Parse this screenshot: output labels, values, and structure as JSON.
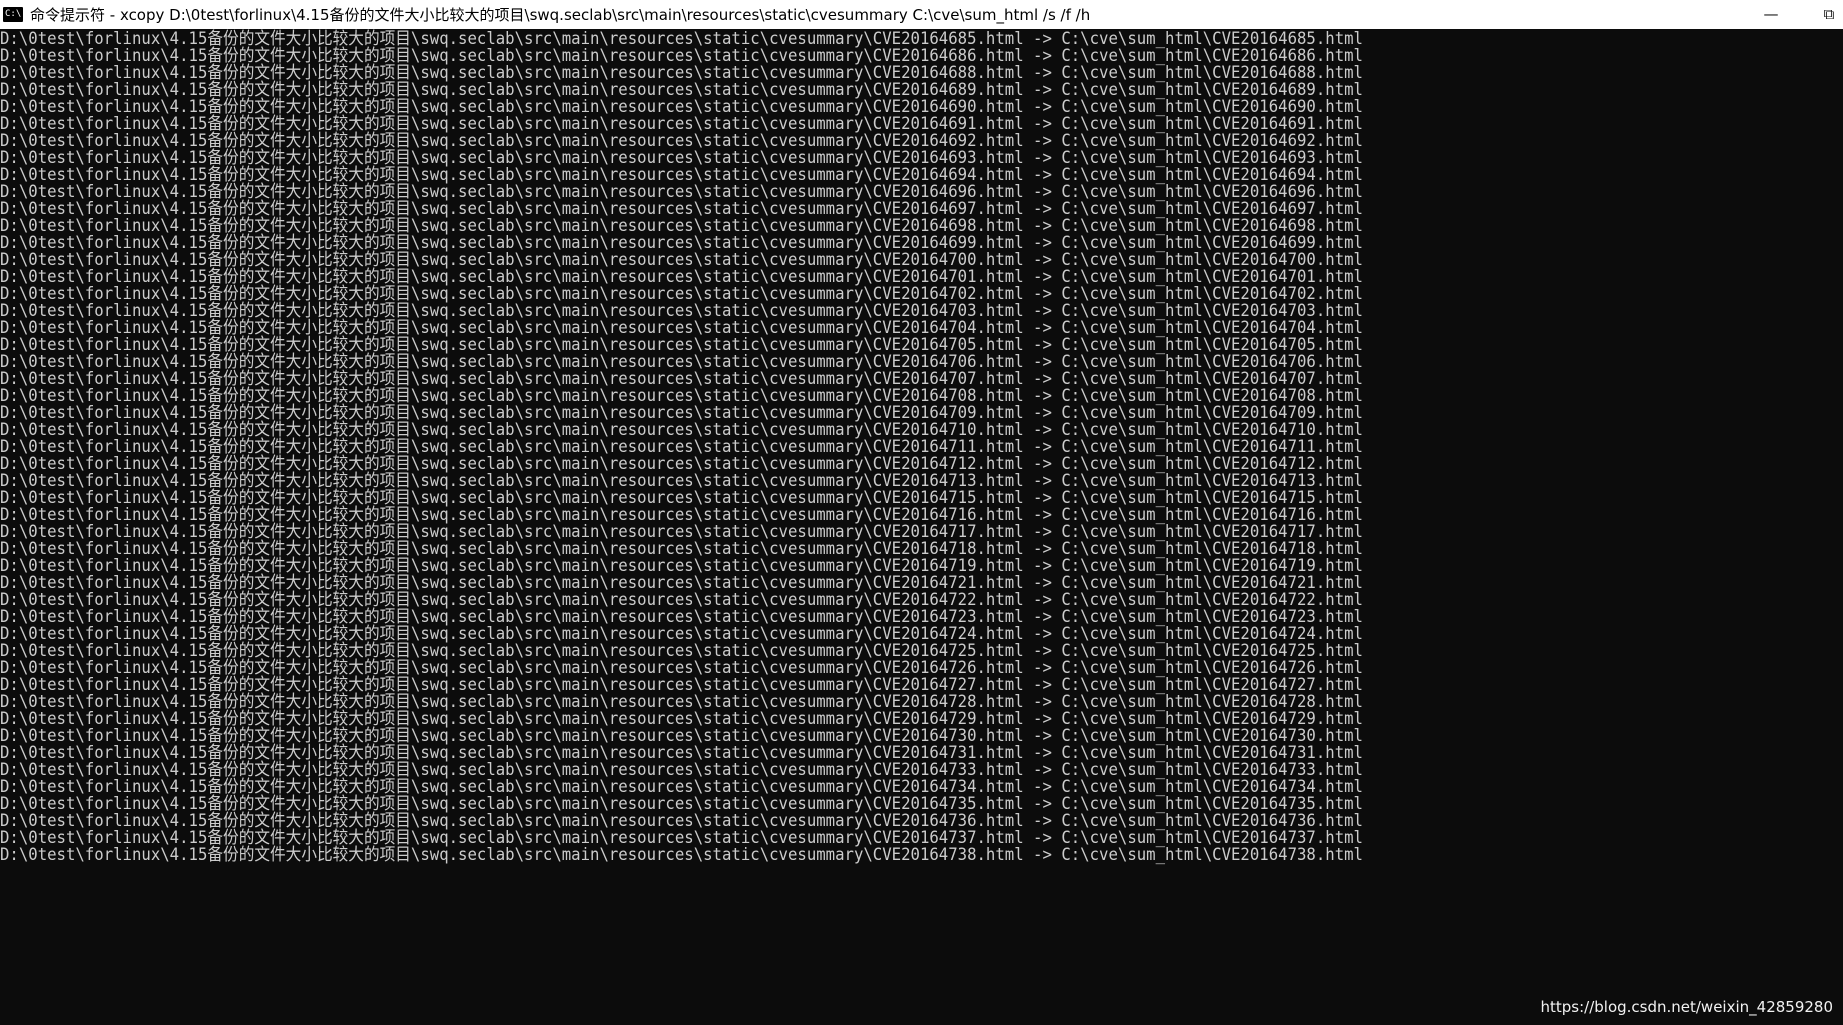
{
  "window": {
    "title": "命令提示符 - xcopy  D:\\0test\\forlinux\\4.15备份的文件大小比较大的项目\\swq.seclab\\src\\main\\resources\\static\\cvesummary C:\\cve\\sum_html /s /f /h",
    "icon_text": "C:\\",
    "minimize_glyph": "—",
    "maximize_glyph": "⧉"
  },
  "console": {
    "lines": [
      "D:\\0test\\forlinux\\4.15备份的文件大小比较大的项目\\swq.seclab\\src\\main\\resources\\static\\cvesummary\\CVE20164685.html -> C:\\cve\\sum_html\\CVE20164685.html",
      "D:\\0test\\forlinux\\4.15备份的文件大小比较大的项目\\swq.seclab\\src\\main\\resources\\static\\cvesummary\\CVE20164686.html -> C:\\cve\\sum_html\\CVE20164686.html",
      "D:\\0test\\forlinux\\4.15备份的文件大小比较大的项目\\swq.seclab\\src\\main\\resources\\static\\cvesummary\\CVE20164688.html -> C:\\cve\\sum_html\\CVE20164688.html",
      "D:\\0test\\forlinux\\4.15备份的文件大小比较大的项目\\swq.seclab\\src\\main\\resources\\static\\cvesummary\\CVE20164689.html -> C:\\cve\\sum_html\\CVE20164689.html",
      "D:\\0test\\forlinux\\4.15备份的文件大小比较大的项目\\swq.seclab\\src\\main\\resources\\static\\cvesummary\\CVE20164690.html -> C:\\cve\\sum_html\\CVE20164690.html",
      "D:\\0test\\forlinux\\4.15备份的文件大小比较大的项目\\swq.seclab\\src\\main\\resources\\static\\cvesummary\\CVE20164691.html -> C:\\cve\\sum_html\\CVE20164691.html",
      "D:\\0test\\forlinux\\4.15备份的文件大小比较大的项目\\swq.seclab\\src\\main\\resources\\static\\cvesummary\\CVE20164692.html -> C:\\cve\\sum_html\\CVE20164692.html",
      "D:\\0test\\forlinux\\4.15备份的文件大小比较大的项目\\swq.seclab\\src\\main\\resources\\static\\cvesummary\\CVE20164693.html -> C:\\cve\\sum_html\\CVE20164693.html",
      "D:\\0test\\forlinux\\4.15备份的文件大小比较大的项目\\swq.seclab\\src\\main\\resources\\static\\cvesummary\\CVE20164694.html -> C:\\cve\\sum_html\\CVE20164694.html",
      "D:\\0test\\forlinux\\4.15备份的文件大小比较大的项目\\swq.seclab\\src\\main\\resources\\static\\cvesummary\\CVE20164696.html -> C:\\cve\\sum_html\\CVE20164696.html",
      "D:\\0test\\forlinux\\4.15备份的文件大小比较大的项目\\swq.seclab\\src\\main\\resources\\static\\cvesummary\\CVE20164697.html -> C:\\cve\\sum_html\\CVE20164697.html",
      "D:\\0test\\forlinux\\4.15备份的文件大小比较大的项目\\swq.seclab\\src\\main\\resources\\static\\cvesummary\\CVE20164698.html -> C:\\cve\\sum_html\\CVE20164698.html",
      "D:\\0test\\forlinux\\4.15备份的文件大小比较大的项目\\swq.seclab\\src\\main\\resources\\static\\cvesummary\\CVE20164699.html -> C:\\cve\\sum_html\\CVE20164699.html",
      "D:\\0test\\forlinux\\4.15备份的文件大小比较大的项目\\swq.seclab\\src\\main\\resources\\static\\cvesummary\\CVE20164700.html -> C:\\cve\\sum_html\\CVE20164700.html",
      "D:\\0test\\forlinux\\4.15备份的文件大小比较大的项目\\swq.seclab\\src\\main\\resources\\static\\cvesummary\\CVE20164701.html -> C:\\cve\\sum_html\\CVE20164701.html",
      "D:\\0test\\forlinux\\4.15备份的文件大小比较大的项目\\swq.seclab\\src\\main\\resources\\static\\cvesummary\\CVE20164702.html -> C:\\cve\\sum_html\\CVE20164702.html",
      "D:\\0test\\forlinux\\4.15备份的文件大小比较大的项目\\swq.seclab\\src\\main\\resources\\static\\cvesummary\\CVE20164703.html -> C:\\cve\\sum_html\\CVE20164703.html",
      "D:\\0test\\forlinux\\4.15备份的文件大小比较大的项目\\swq.seclab\\src\\main\\resources\\static\\cvesummary\\CVE20164704.html -> C:\\cve\\sum_html\\CVE20164704.html",
      "D:\\0test\\forlinux\\4.15备份的文件大小比较大的项目\\swq.seclab\\src\\main\\resources\\static\\cvesummary\\CVE20164705.html -> C:\\cve\\sum_html\\CVE20164705.html",
      "D:\\0test\\forlinux\\4.15备份的文件大小比较大的项目\\swq.seclab\\src\\main\\resources\\static\\cvesummary\\CVE20164706.html -> C:\\cve\\sum_html\\CVE20164706.html",
      "D:\\0test\\forlinux\\4.15备份的文件大小比较大的项目\\swq.seclab\\src\\main\\resources\\static\\cvesummary\\CVE20164707.html -> C:\\cve\\sum_html\\CVE20164707.html",
      "D:\\0test\\forlinux\\4.15备份的文件大小比较大的项目\\swq.seclab\\src\\main\\resources\\static\\cvesummary\\CVE20164708.html -> C:\\cve\\sum_html\\CVE20164708.html",
      "D:\\0test\\forlinux\\4.15备份的文件大小比较大的项目\\swq.seclab\\src\\main\\resources\\static\\cvesummary\\CVE20164709.html -> C:\\cve\\sum_html\\CVE20164709.html",
      "D:\\0test\\forlinux\\4.15备份的文件大小比较大的项目\\swq.seclab\\src\\main\\resources\\static\\cvesummary\\CVE20164710.html -> C:\\cve\\sum_html\\CVE20164710.html",
      "D:\\0test\\forlinux\\4.15备份的文件大小比较大的项目\\swq.seclab\\src\\main\\resources\\static\\cvesummary\\CVE20164711.html -> C:\\cve\\sum_html\\CVE20164711.html",
      "D:\\0test\\forlinux\\4.15备份的文件大小比较大的项目\\swq.seclab\\src\\main\\resources\\static\\cvesummary\\CVE20164712.html -> C:\\cve\\sum_html\\CVE20164712.html",
      "D:\\0test\\forlinux\\4.15备份的文件大小比较大的项目\\swq.seclab\\src\\main\\resources\\static\\cvesummary\\CVE20164713.html -> C:\\cve\\sum_html\\CVE20164713.html",
      "D:\\0test\\forlinux\\4.15备份的文件大小比较大的项目\\swq.seclab\\src\\main\\resources\\static\\cvesummary\\CVE20164715.html -> C:\\cve\\sum_html\\CVE20164715.html",
      "D:\\0test\\forlinux\\4.15备份的文件大小比较大的项目\\swq.seclab\\src\\main\\resources\\static\\cvesummary\\CVE20164716.html -> C:\\cve\\sum_html\\CVE20164716.html",
      "D:\\0test\\forlinux\\4.15备份的文件大小比较大的项目\\swq.seclab\\src\\main\\resources\\static\\cvesummary\\CVE20164717.html -> C:\\cve\\sum_html\\CVE20164717.html",
      "D:\\0test\\forlinux\\4.15备份的文件大小比较大的项目\\swq.seclab\\src\\main\\resources\\static\\cvesummary\\CVE20164718.html -> C:\\cve\\sum_html\\CVE20164718.html",
      "D:\\0test\\forlinux\\4.15备份的文件大小比较大的项目\\swq.seclab\\src\\main\\resources\\static\\cvesummary\\CVE20164719.html -> C:\\cve\\sum_html\\CVE20164719.html",
      "D:\\0test\\forlinux\\4.15备份的文件大小比较大的项目\\swq.seclab\\src\\main\\resources\\static\\cvesummary\\CVE20164721.html -> C:\\cve\\sum_html\\CVE20164721.html",
      "D:\\0test\\forlinux\\4.15备份的文件大小比较大的项目\\swq.seclab\\src\\main\\resources\\static\\cvesummary\\CVE20164722.html -> C:\\cve\\sum_html\\CVE20164722.html",
      "D:\\0test\\forlinux\\4.15备份的文件大小比较大的项目\\swq.seclab\\src\\main\\resources\\static\\cvesummary\\CVE20164723.html -> C:\\cve\\sum_html\\CVE20164723.html",
      "D:\\0test\\forlinux\\4.15备份的文件大小比较大的项目\\swq.seclab\\src\\main\\resources\\static\\cvesummary\\CVE20164724.html -> C:\\cve\\sum_html\\CVE20164724.html",
      "D:\\0test\\forlinux\\4.15备份的文件大小比较大的项目\\swq.seclab\\src\\main\\resources\\static\\cvesummary\\CVE20164725.html -> C:\\cve\\sum_html\\CVE20164725.html",
      "D:\\0test\\forlinux\\4.15备份的文件大小比较大的项目\\swq.seclab\\src\\main\\resources\\static\\cvesummary\\CVE20164726.html -> C:\\cve\\sum_html\\CVE20164726.html",
      "D:\\0test\\forlinux\\4.15备份的文件大小比较大的项目\\swq.seclab\\src\\main\\resources\\static\\cvesummary\\CVE20164727.html -> C:\\cve\\sum_html\\CVE20164727.html",
      "D:\\0test\\forlinux\\4.15备份的文件大小比较大的项目\\swq.seclab\\src\\main\\resources\\static\\cvesummary\\CVE20164728.html -> C:\\cve\\sum_html\\CVE20164728.html",
      "D:\\0test\\forlinux\\4.15备份的文件大小比较大的项目\\swq.seclab\\src\\main\\resources\\static\\cvesummary\\CVE20164729.html -> C:\\cve\\sum_html\\CVE20164729.html",
      "D:\\0test\\forlinux\\4.15备份的文件大小比较大的项目\\swq.seclab\\src\\main\\resources\\static\\cvesummary\\CVE20164730.html -> C:\\cve\\sum_html\\CVE20164730.html",
      "D:\\0test\\forlinux\\4.15备份的文件大小比较大的项目\\swq.seclab\\src\\main\\resources\\static\\cvesummary\\CVE20164731.html -> C:\\cve\\sum_html\\CVE20164731.html",
      "D:\\0test\\forlinux\\4.15备份的文件大小比较大的项目\\swq.seclab\\src\\main\\resources\\static\\cvesummary\\CVE20164733.html -> C:\\cve\\sum_html\\CVE20164733.html",
      "D:\\0test\\forlinux\\4.15备份的文件大小比较大的项目\\swq.seclab\\src\\main\\resources\\static\\cvesummary\\CVE20164734.html -> C:\\cve\\sum_html\\CVE20164734.html",
      "D:\\0test\\forlinux\\4.15备份的文件大小比较大的项目\\swq.seclab\\src\\main\\resources\\static\\cvesummary\\CVE20164735.html -> C:\\cve\\sum_html\\CVE20164735.html",
      "D:\\0test\\forlinux\\4.15备份的文件大小比较大的项目\\swq.seclab\\src\\main\\resources\\static\\cvesummary\\CVE20164736.html -> C:\\cve\\sum_html\\CVE20164736.html",
      "D:\\0test\\forlinux\\4.15备份的文件大小比较大的项目\\swq.seclab\\src\\main\\resources\\static\\cvesummary\\CVE20164737.html -> C:\\cve\\sum_html\\CVE20164737.html",
      "D:\\0test\\forlinux\\4.15备份的文件大小比较大的项目\\swq.seclab\\src\\main\\resources\\static\\cvesummary\\CVE20164738.html -> C:\\cve\\sum_html\\CVE20164738.html"
    ]
  },
  "watermark": "https://blog.csdn.net/weixin_42859280",
  "colors": {
    "console_bg": "#0c0c0c",
    "console_fg": "#cccccc",
    "titlebar_bg": "#ffffff"
  }
}
